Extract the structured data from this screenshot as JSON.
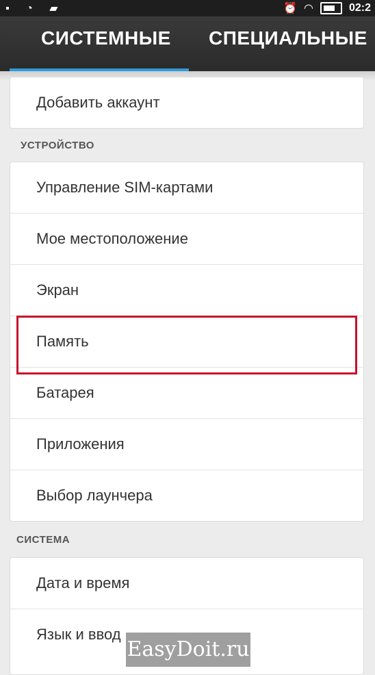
{
  "status_bar": {
    "left_icons": "▪ ◔ ▰",
    "time": "02:2"
  },
  "tabs": [
    {
      "label": "СИСТЕМНЫЕ",
      "active": true
    },
    {
      "label": "СПЕЦИАЛЬНЫЕ",
      "active": false
    }
  ],
  "accounts": {
    "add_account": "Добавить аккаунт"
  },
  "device": {
    "section_title": "УСТРОЙСТВО",
    "items": [
      "Управление SIM-картами",
      "Мое местоположение",
      "Экран",
      "Память",
      "Батарея",
      "Приложения",
      "Выбор лаунчера"
    ]
  },
  "system": {
    "section_title": "СИСТЕМА",
    "items": [
      "Дата и время",
      "Язык и ввод"
    ]
  },
  "highlight_color": "#c8102e",
  "accent_color": "#2f9bd8",
  "watermark": "EasyDoit.ru"
}
